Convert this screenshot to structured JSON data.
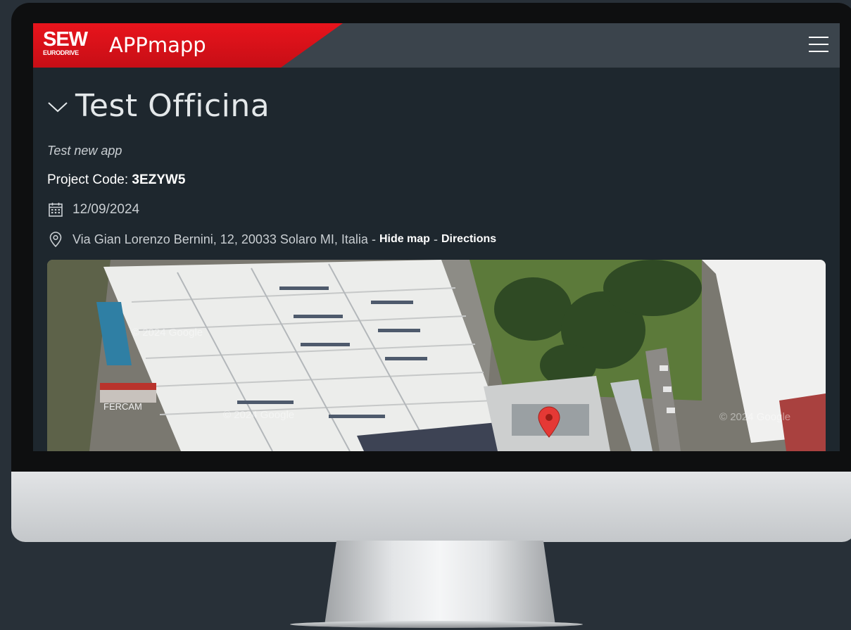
{
  "app": {
    "logo_text": "SEW",
    "logo_subtext": "EURODRIVE",
    "name": "APPmapp"
  },
  "project": {
    "title": "Test Officina",
    "description": "Test new app",
    "code_label": "Project Code:",
    "code_value": "3EZYW5",
    "date": "12/09/2024",
    "address": "Via Gian Lorenzo Bernini, 12, 20033 Solaro MI, Italia",
    "hide_map_label": "Hide map",
    "directions_label": "Directions",
    "separator": "-"
  },
  "map": {
    "marker_color": "#e53935",
    "credit_left": "© 2024 Google",
    "credit_mid": "© 2024 Google",
    "credit_right": "© 2024 Google",
    "truck_text": "FERCAM"
  },
  "colors": {
    "brand_red": "#e8141c",
    "header_bg": "#3b444c",
    "page_bg": "#1e272e",
    "outer_bg": "#283038"
  },
  "icons": {
    "menu": "hamburger-icon",
    "collapse": "chevron-down-icon",
    "date": "calendar-icon",
    "address": "location-pin-icon",
    "map_marker": "map-marker-icon"
  }
}
